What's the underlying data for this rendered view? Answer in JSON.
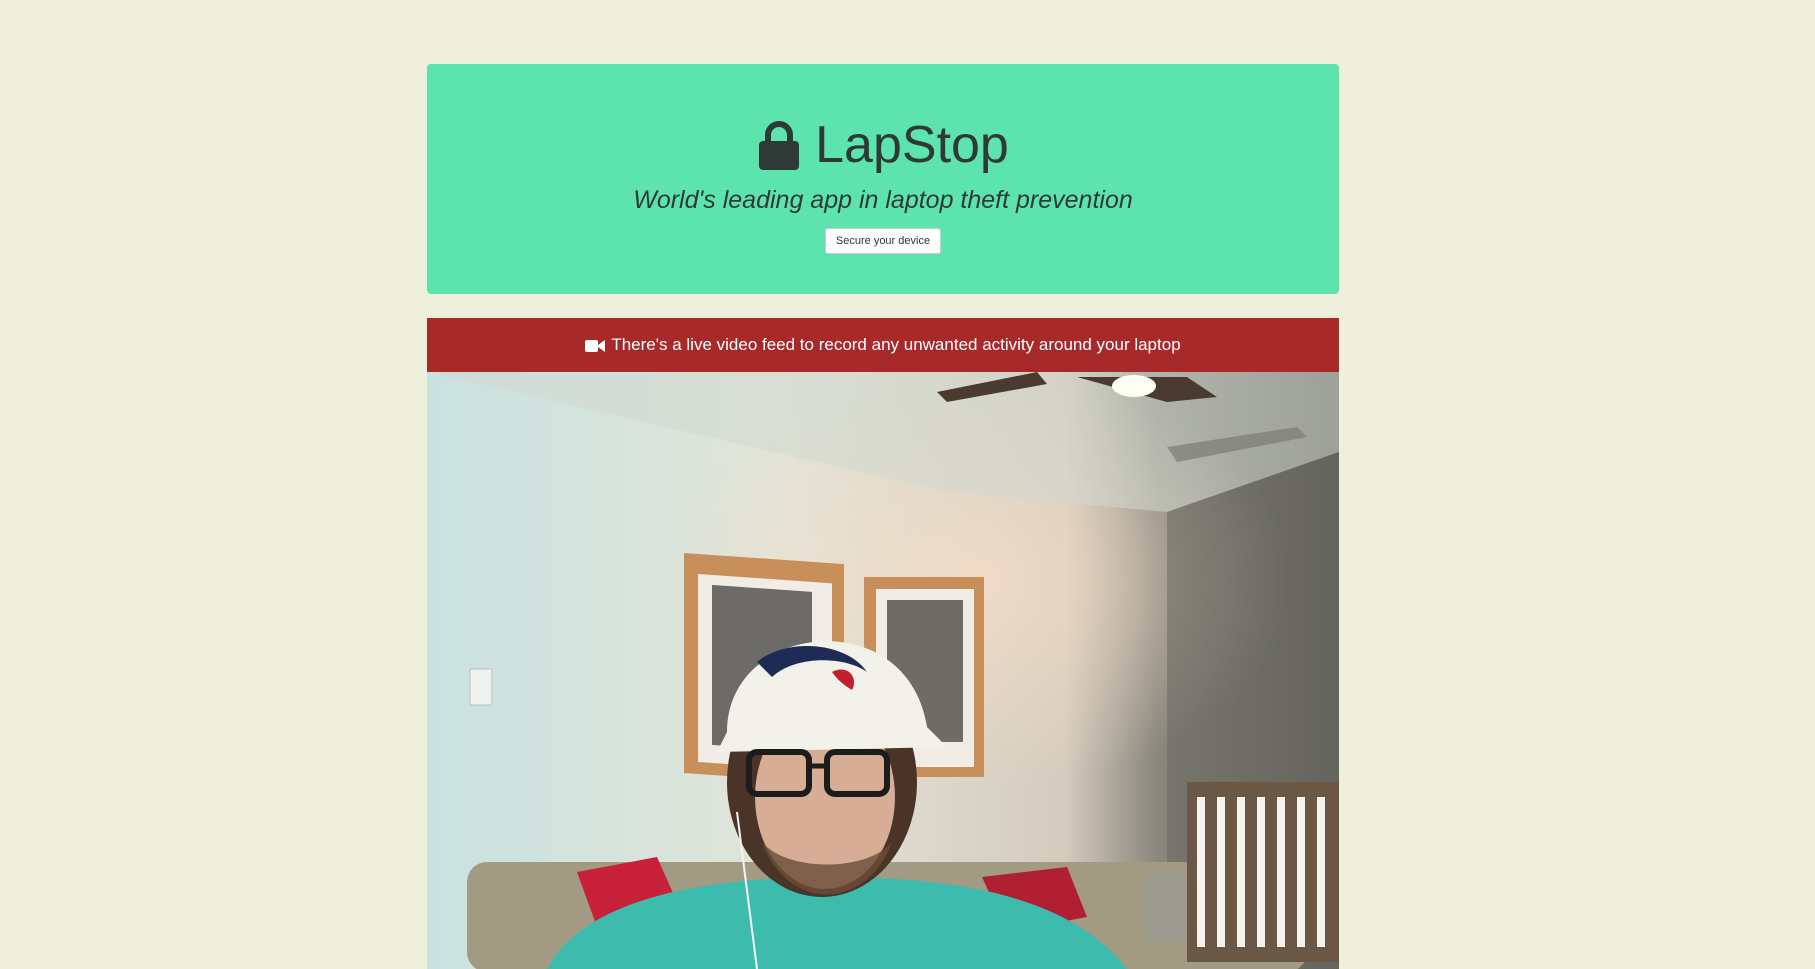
{
  "header": {
    "icon": "lock-icon",
    "app_name": "LapStop",
    "tagline": "World's leading app in laptop theft prevention",
    "secure_button_label": "Secure your device"
  },
  "feed": {
    "icon": "video-camera-icon",
    "banner_text": "There's a live video feed to record any unwanted activity around your laptop"
  },
  "colors": {
    "page_background": "#eef0dc",
    "hero_background": "#5de3ae",
    "banner_background": "#a8292a"
  }
}
